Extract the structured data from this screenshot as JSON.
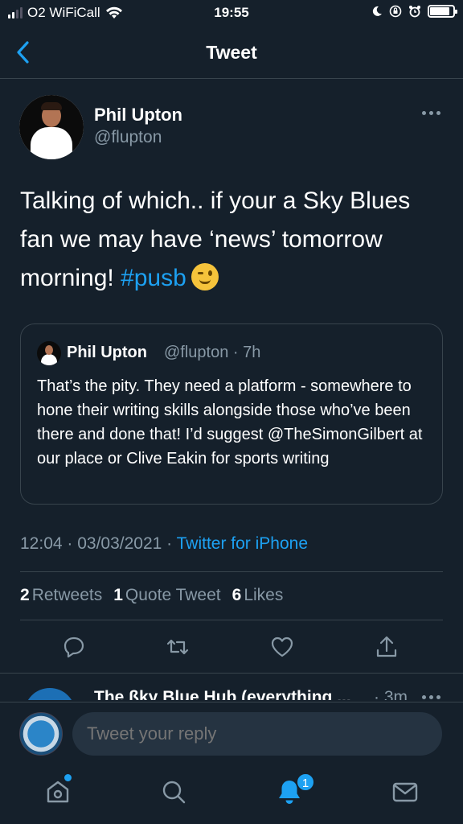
{
  "status_bar": {
    "carrier": "O2 WiFiCall",
    "time": "19:55",
    "battery_level": 0.85
  },
  "nav": {
    "title": "Tweet",
    "back_icon": "chevron-left-icon"
  },
  "tweet": {
    "author_name": "Phil Upton",
    "author_handle": "@flupton",
    "text_part1": "Talking of which..  if your a Sky Blues fan we may have ‘news’ tomorrow morning! ",
    "hashtag": "#pusb",
    "emoji": "winking-face",
    "quote": {
      "author_name": "Phil Upton",
      "meta": "@flupton · 7h",
      "text": "That’s the pity. They need a platform - somewhere to hone their writing skills alongside those who’ve been there and done that! I’d suggest @TheSimonGilbert at our place or Clive Eakin for sports writing"
    },
    "timestamp": "12:04 · 03/03/2021 · ",
    "source": "Twitter for iPhone",
    "stats": {
      "retweets_count": "2",
      "retweets_label": "Retweets",
      "quotes_count": "1",
      "quotes_label": "Quote Tweet",
      "likes_count": "6",
      "likes_label": "Likes"
    }
  },
  "next_tweet": {
    "author_name": "The ßky Blue Hub (everything ...",
    "meta": "· 3m"
  },
  "reply": {
    "placeholder": "Tweet your reply"
  },
  "tabbar": {
    "notifications_badge": "1"
  },
  "colors": {
    "background": "#15202b",
    "accent": "#1da1f2",
    "muted": "#8899a6",
    "divider": "#38444d"
  }
}
